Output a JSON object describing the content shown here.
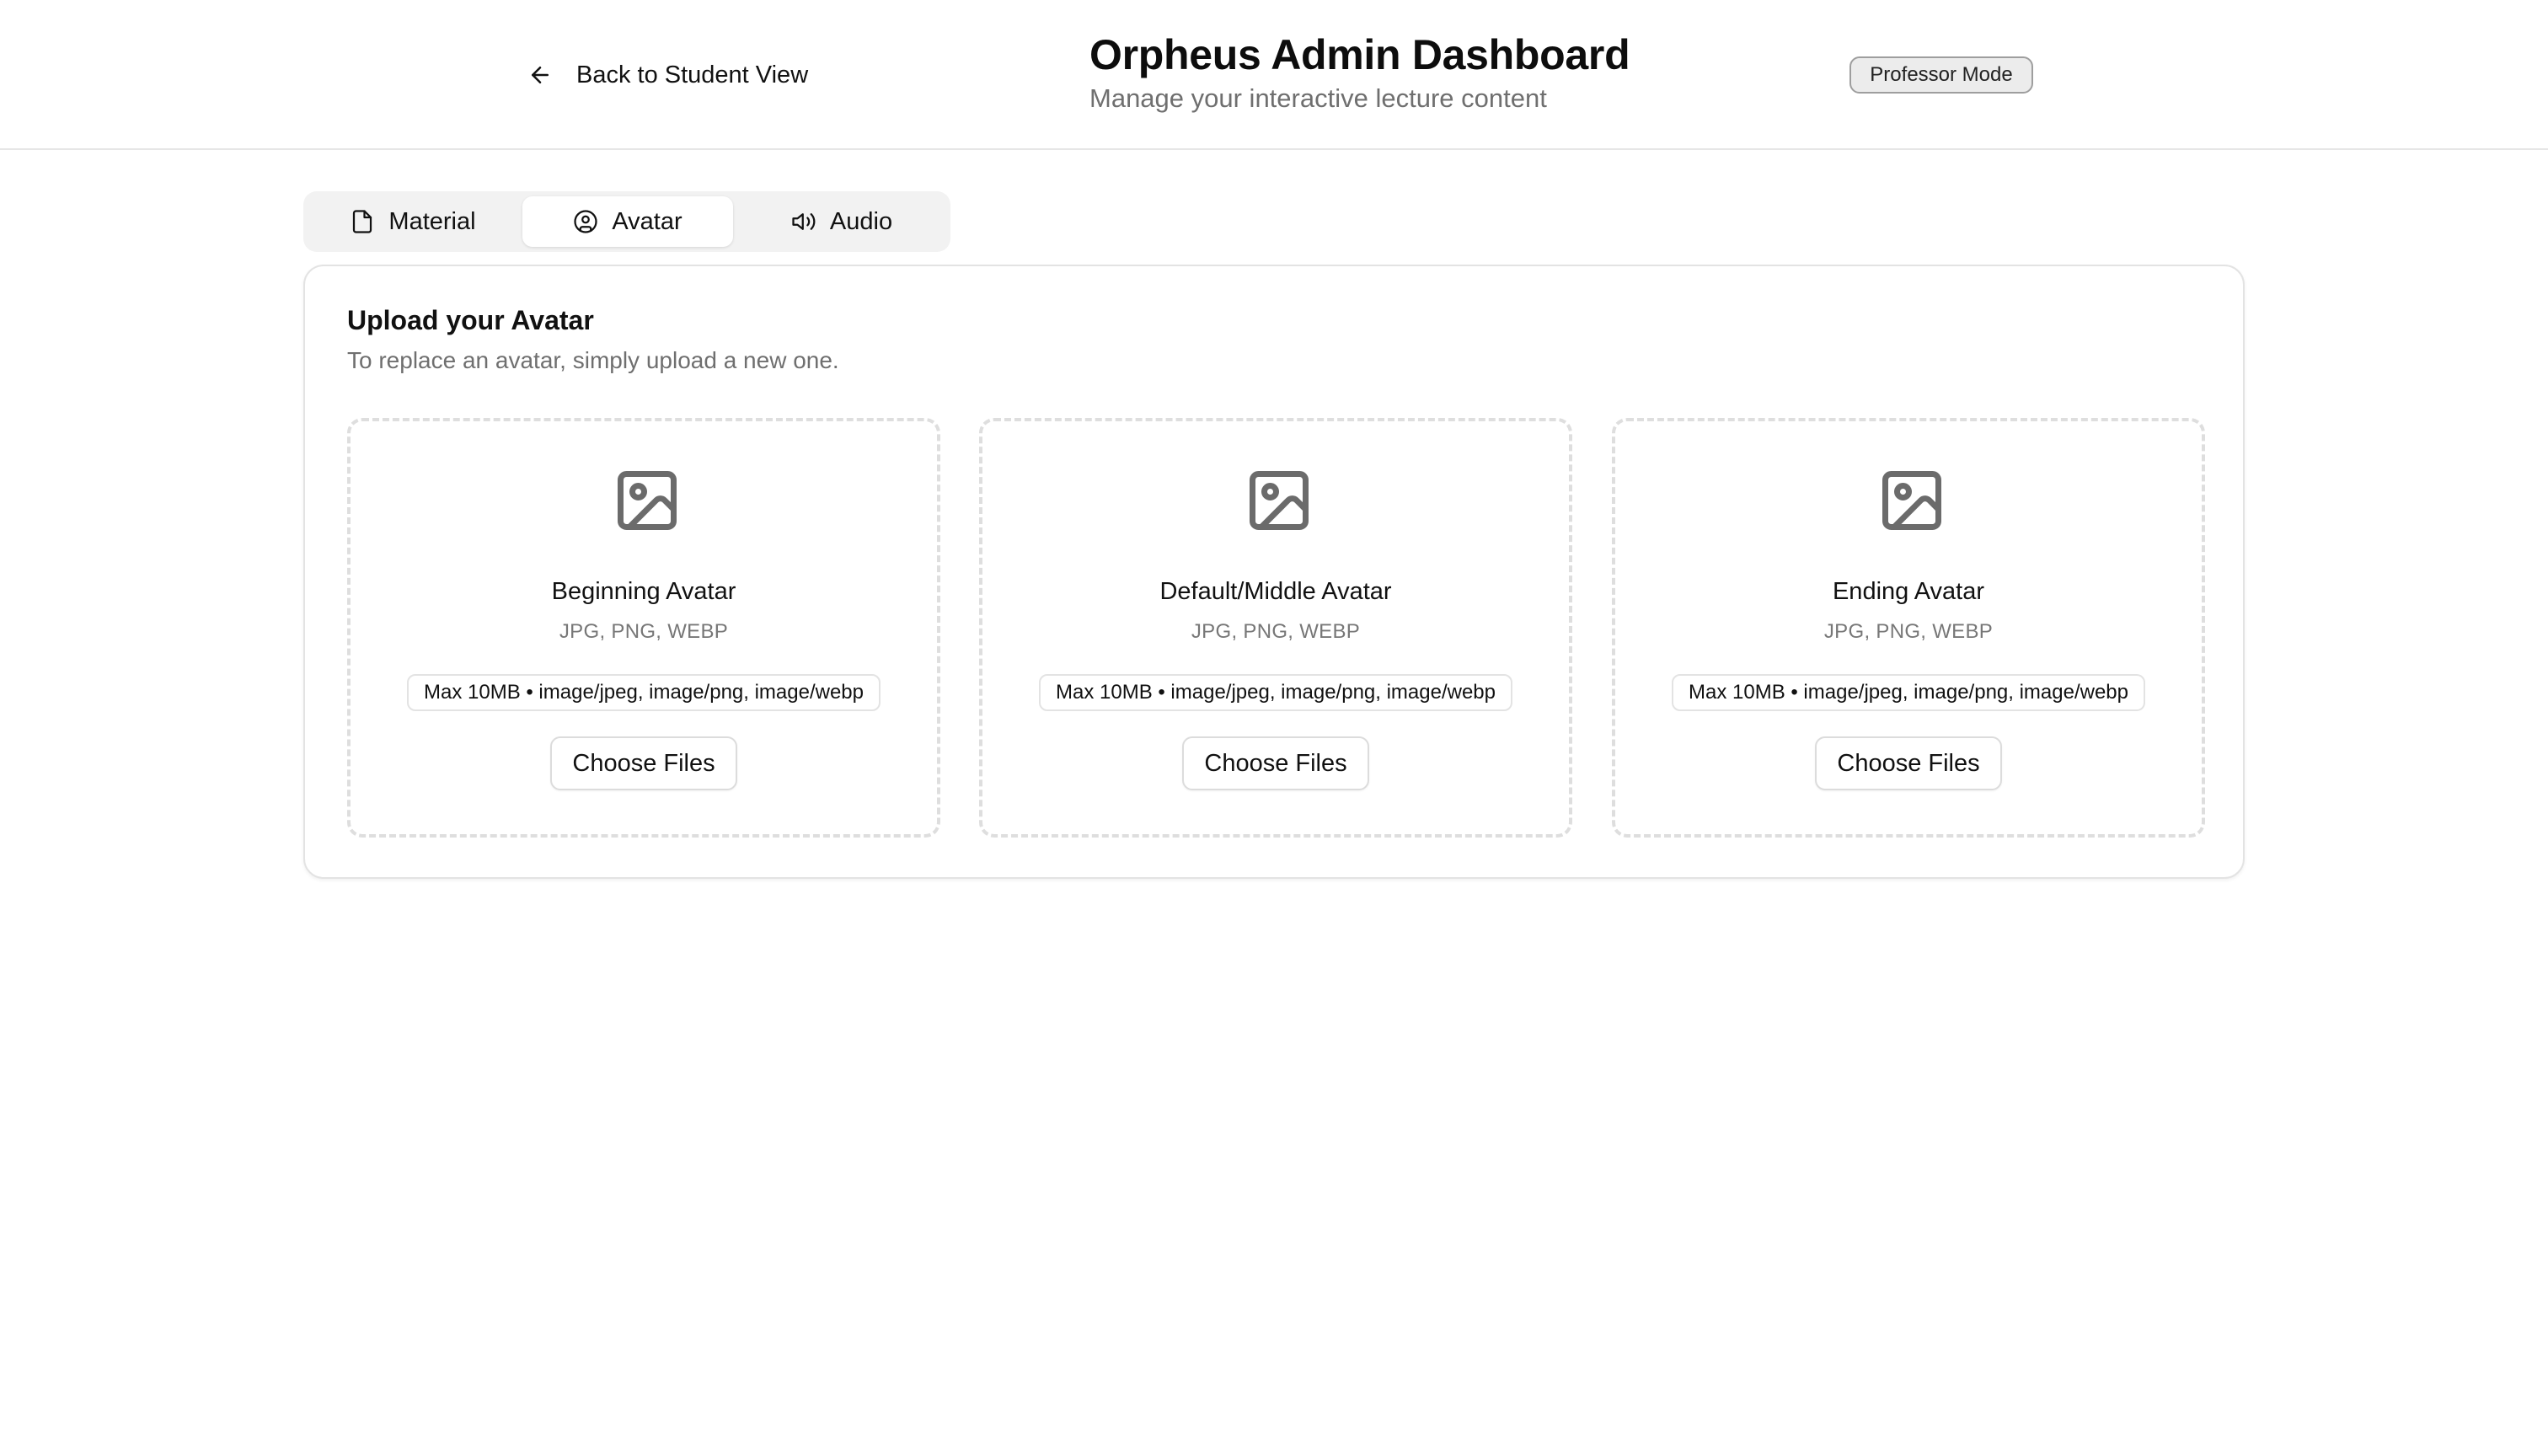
{
  "header": {
    "back_label": "Back to Student View",
    "back_icon": "arrow-left-icon",
    "title": "Orpheus Admin Dashboard",
    "subtitle": "Manage your interactive lecture content",
    "mode_badge": "Professor Mode"
  },
  "tabs": [
    {
      "label": "Material",
      "icon": "file-icon",
      "active": false
    },
    {
      "label": "Avatar",
      "icon": "user-circle-icon",
      "active": true
    },
    {
      "label": "Audio",
      "icon": "speaker-icon",
      "active": false
    }
  ],
  "upload": {
    "title": "Upload your Avatar",
    "description": "To replace an avatar, simply upload a new one.",
    "zones": [
      {
        "title": "Beginning Avatar",
        "types": "JPG, PNG, WEBP",
        "limit": "Max 10MB • image/jpeg, image/png, image/webp",
        "button": "Choose Files",
        "icon": "image-icon"
      },
      {
        "title": "Default/Middle Avatar",
        "types": "JPG, PNG, WEBP",
        "limit": "Max 10MB • image/jpeg, image/png, image/webp",
        "button": "Choose Files",
        "icon": "image-icon"
      },
      {
        "title": "Ending Avatar",
        "types": "JPG, PNG, WEBP",
        "limit": "Max 10MB • image/jpeg, image/png, image/webp",
        "button": "Choose Files",
        "icon": "image-icon"
      }
    ]
  },
  "colors": {
    "text": "#111111",
    "muted": "#6f6f6f",
    "border": "#e3e3e3",
    "icon": "#6b6b6b",
    "tab_bg": "#f2f2f2"
  }
}
